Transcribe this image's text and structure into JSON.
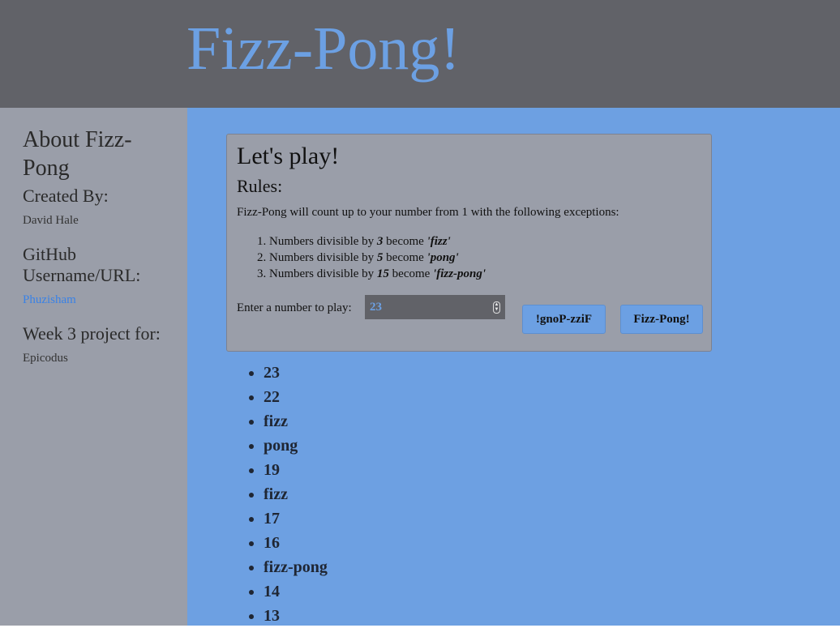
{
  "header": {
    "title": "Fizz-Pong!"
  },
  "sidebar": {
    "about_title": "About Fizz-Pong",
    "created_by_label": "Created By:",
    "created_by_value": "David Hale",
    "github_label": "GitHub Username/URL:",
    "github_value": "Phuzisham",
    "project_label": "Week 3 project for:",
    "project_value": "Epicodus"
  },
  "panel": {
    "title": "Let's play!",
    "rules_title": "Rules:",
    "rules_desc": "Fizz-Pong will count up to your number from 1 with the following exceptions:",
    "rules": [
      {
        "prefix": "Numbers divisible by ",
        "number": "3",
        "mid": " become ",
        "word": "'fizz'"
      },
      {
        "prefix": "Numbers divisible by ",
        "number": "5",
        "mid": " become ",
        "word": "'pong'"
      },
      {
        "prefix": "Numbers divisible by ",
        "number": "15",
        "mid": " become ",
        "word": "'fizz-pong'"
      }
    ],
    "input_label": "Enter a number to play:",
    "input_value": "23",
    "reverse_button": "!gnoP-zziF",
    "play_button": "Fizz-Pong!"
  },
  "results": [
    "23",
    "22",
    "fizz",
    "pong",
    "19",
    "fizz",
    "17",
    "16",
    "fizz-pong",
    "14",
    "13"
  ],
  "colors": {
    "header_bg": "#616268",
    "accent": "#6ca0e3",
    "sidebar_bg": "#9a9ea9",
    "main_bg": "#6da0e2",
    "link": "#3a82e6"
  }
}
